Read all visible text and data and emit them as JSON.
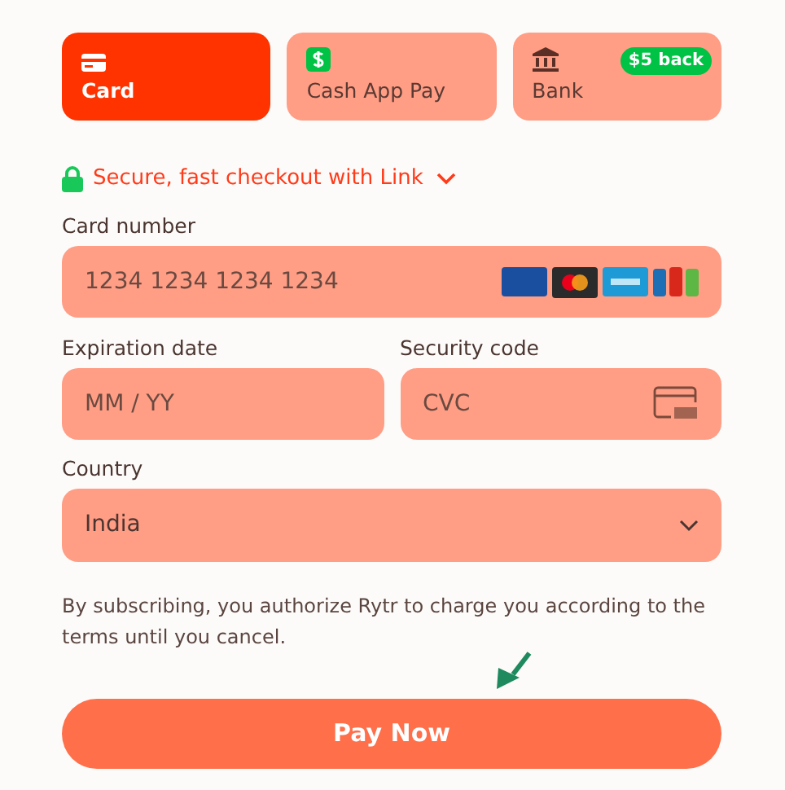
{
  "payment_methods": [
    {
      "label": "Card",
      "kind": "card",
      "selected": true
    },
    {
      "label": "Cash App Pay",
      "kind": "cashapp",
      "selected": false
    },
    {
      "label": "Bank",
      "kind": "bank",
      "selected": false,
      "badge": "$5 back"
    }
  ],
  "link_banner": {
    "text": "Secure, fast checkout with Link"
  },
  "card_number": {
    "label": "Card number",
    "placeholder": "1234 1234 1234 1234"
  },
  "expiration": {
    "label": "Expiration date",
    "placeholder": "MM / YY"
  },
  "security_code": {
    "label": "Security code",
    "placeholder": "CVC"
  },
  "country": {
    "label": "Country",
    "value": "India"
  },
  "terms": "By subscribing, you authorize Rytr to charge you according to the terms until you cancel.",
  "pay_button": "Pay Now"
}
